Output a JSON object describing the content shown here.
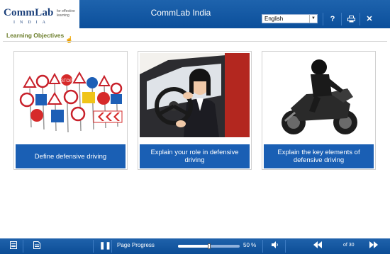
{
  "header": {
    "logo_text": "CommLab",
    "logo_sub": "INDIA",
    "logo_tagline": "for effective learning",
    "title": "CommLab India",
    "language": "English",
    "help_label": "?",
    "close_label": "✕"
  },
  "content": {
    "section_title": "Learning Objectives",
    "cards": [
      {
        "label": "Define defensive driving",
        "image": "road-signs"
      },
      {
        "label": "Explain your role in defensive driving",
        "image": "woman-driving-car"
      },
      {
        "label": "Explain the key elements of defensive driving",
        "image": "motorcycle-rider"
      }
    ]
  },
  "footer": {
    "progress_label": "Page Progress",
    "progress_percent": "50 %",
    "progress_value": 0.5,
    "page_count": "of 30"
  },
  "colors": {
    "header_blue": "#0b4f9b",
    "card_label_blue": "#1a5fb4",
    "title_olive": "#6b7d2a"
  }
}
